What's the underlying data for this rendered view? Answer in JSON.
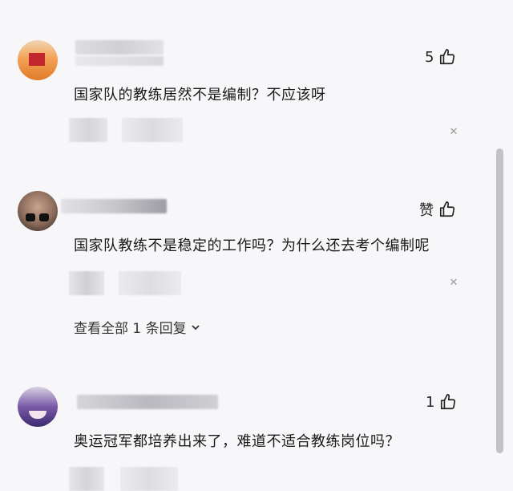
{
  "comments": [
    {
      "text": "国家队的教练居然不是编制？不应该呀",
      "likes": "5"
    },
    {
      "text": "国家队教练不是稳定的工作吗？为什么还去考个编制呢",
      "likes": "赞",
      "replies_label": "查看全部 1 条回复"
    },
    {
      "text": "奥运冠军都培养出来了，难道不适合教练岗位吗？",
      "likes": "1"
    }
  ],
  "icons": {
    "like": "thumbs-up-icon",
    "close": "close-icon",
    "expand": "chevron-down-icon"
  },
  "colors": {
    "background": "#f7f7f9",
    "text": "#1a1a1a",
    "muted": "#9a9a9a"
  }
}
